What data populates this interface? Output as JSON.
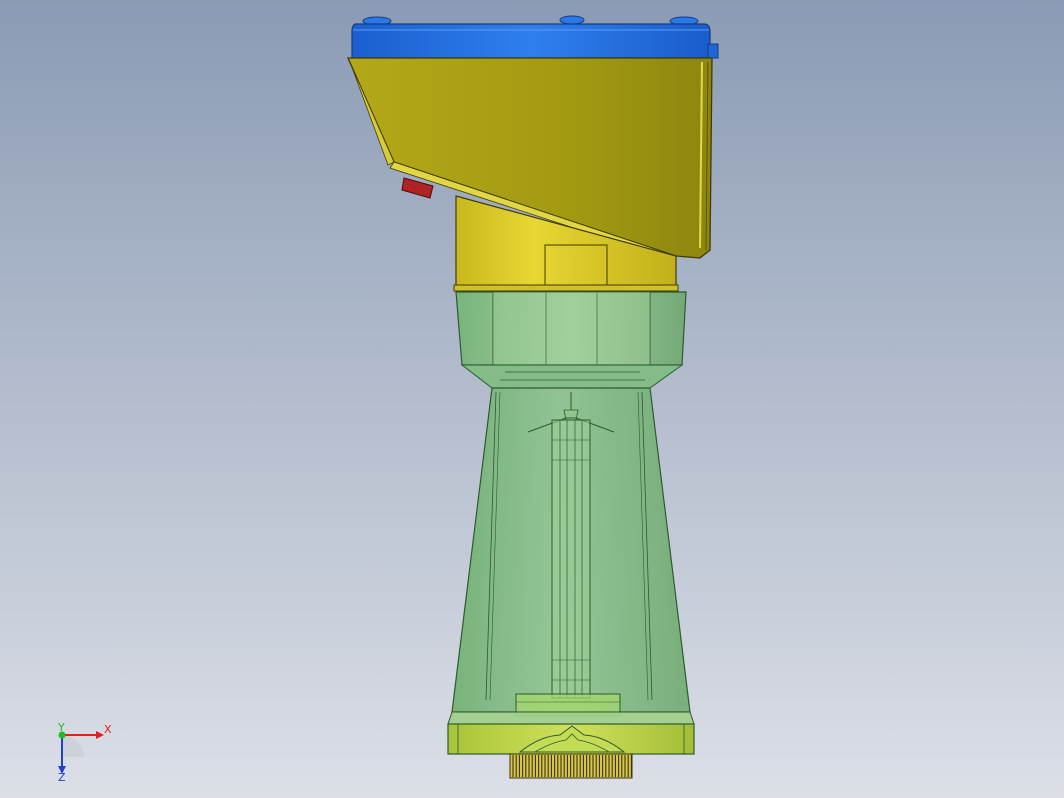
{
  "viewport": {
    "background_top": "#8b9bb5",
    "background_bottom": "#dcdfe6"
  },
  "model": {
    "parts": [
      {
        "name": "top-cover",
        "color": "#1f6fe0"
      },
      {
        "name": "housing-head",
        "color": "#a9a117"
      },
      {
        "name": "neck-collar",
        "color": "#d9c92a"
      },
      {
        "name": "status-led",
        "color": "#b12222"
      },
      {
        "name": "horn-antenna",
        "color": "#5fae5f"
      },
      {
        "name": "flange-base",
        "color": "#c7d94a"
      },
      {
        "name": "thread-ring",
        "color": "#d8c64a"
      }
    ]
  },
  "triad": {
    "x_label": "X",
    "y_label": "Y",
    "z_label": "Z",
    "x_color": "#e02020",
    "y_color": "#22bb22",
    "z_color": "#2040d0"
  }
}
